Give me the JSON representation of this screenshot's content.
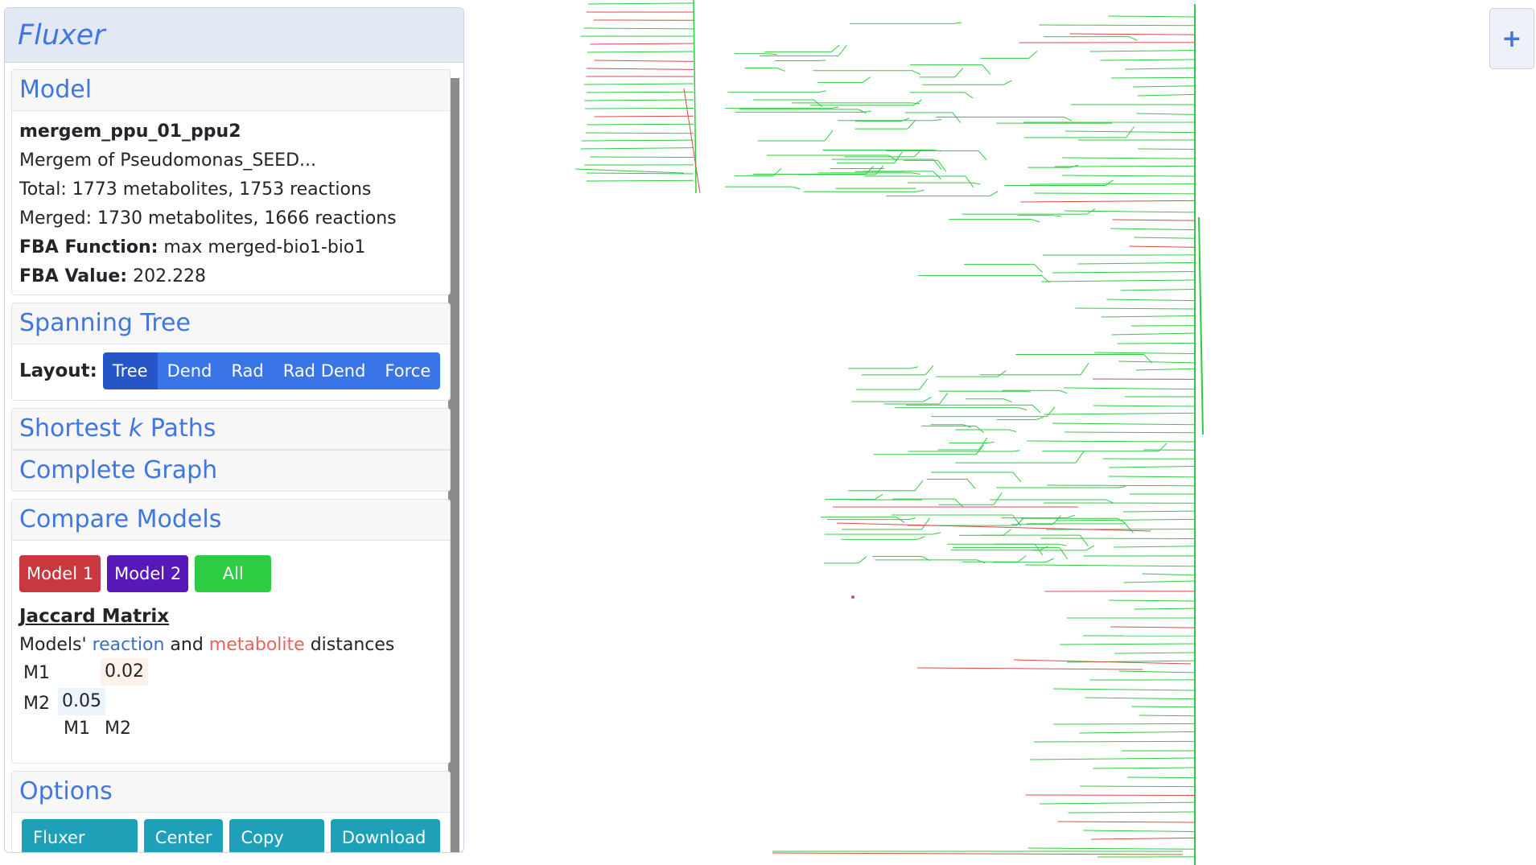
{
  "app": {
    "title": "Fluxer"
  },
  "model_section": {
    "header": "Model",
    "name": "mergem_ppu_01_ppu2",
    "description": "Mergem of Pseudomonas_SEED...",
    "total": "Total: 1773 metabolites, 1753 reactions",
    "merged": "Merged: 1730 metabolites, 1666 reactions",
    "fba_function_label": "FBA Function:",
    "fba_function_value": "max merged-bio1-bio1",
    "fba_value_label": "FBA Value:",
    "fba_value": "202.228"
  },
  "spanning_tree": {
    "header": "Spanning Tree",
    "layout_label": "Layout:",
    "layouts": [
      "Tree",
      "Dend",
      "Rad",
      "Rad Dend",
      "Force"
    ],
    "active_layout": "Tree"
  },
  "shortest_paths": {
    "header_prefix": "Shortest ",
    "header_k": "k",
    "header_suffix": " Paths"
  },
  "complete_graph": {
    "header": "Complete Graph"
  },
  "compare_models": {
    "header": "Compare Models",
    "buttons": {
      "model1": "Model 1",
      "model2": "Model 2",
      "all": "All"
    },
    "jaccard_title": "Jaccard Matrix",
    "desc_prefix": "Models'",
    "desc_reaction": "reaction",
    "desc_and": "and",
    "desc_metabolite": "metabolite",
    "desc_suffix": "distances",
    "matrix": {
      "row_labels": [
        "M1",
        "M2"
      ],
      "col_labels": [
        "M1",
        "M2"
      ],
      "m1_m2_metabolite": "0.02",
      "m2_m1_reaction": "0.05"
    },
    "colors": {
      "reaction": "#3a6fc4",
      "metabolite": "#e8645a",
      "model1": "#c9373f",
      "model2": "#5619b8",
      "all": "#2ecc40"
    }
  },
  "options": {
    "header": "Options",
    "buttons": {
      "home": "Fluxer Home",
      "center": "Center",
      "copy_link": "Copy Link",
      "download": "Download"
    }
  },
  "zoom": {
    "label": "+"
  },
  "graph": {
    "edge_colors": {
      "shared": "#2ecc40",
      "model1": "#e04a4a"
    }
  }
}
